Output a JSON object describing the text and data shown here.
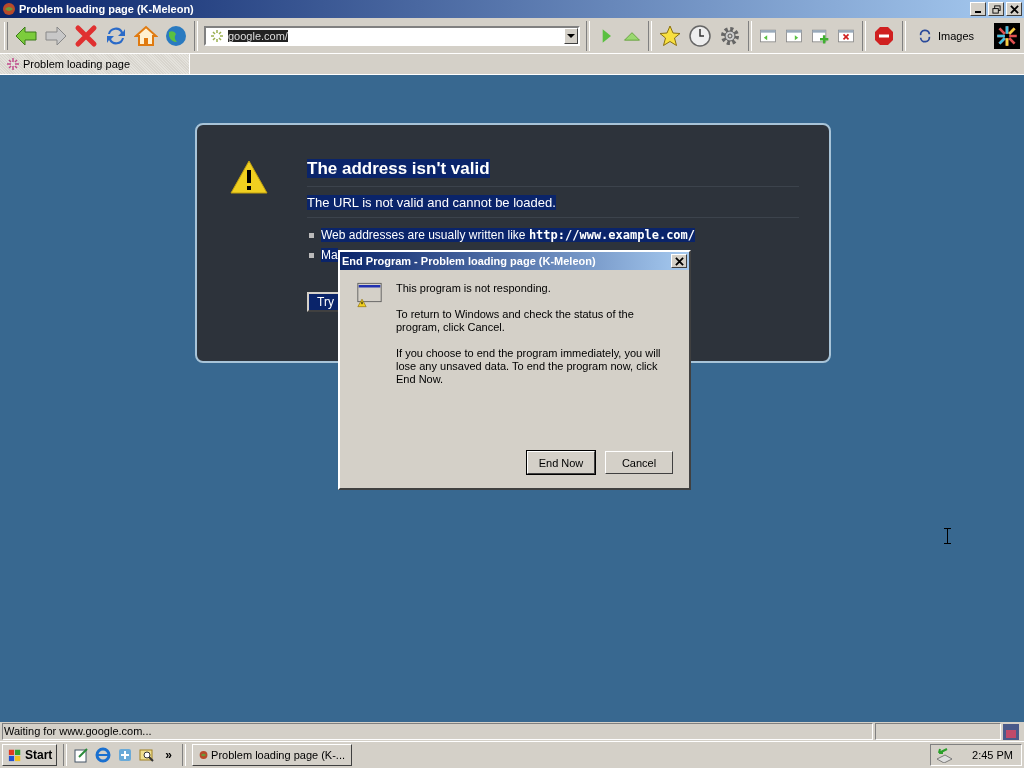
{
  "window": {
    "title": "Problem loading page (K-Meleon)"
  },
  "toolbar": {
    "address": "google.com/",
    "images_button": "Images"
  },
  "tabs": [
    {
      "label": "Problem loading page",
      "selected": true
    }
  ],
  "error_page": {
    "title": "The address isn't valid",
    "subtitle": "The URL is not valid and cannot be loaded.",
    "bullets": [
      "Web addresses are usually written like **http://www.example.com/**",
      "Ma"
    ],
    "button": "Try"
  },
  "dialog": {
    "title": "End Program - Problem loading page (K-Meleon)",
    "paragraphs": [
      "This program is not responding.",
      "To return to Windows and check the status of the program, click Cancel.",
      "If you choose to end the program immediately, you will lose any unsaved data. To end the program now, click End Now."
    ],
    "buttons": [
      {
        "label": "End Now",
        "default": true
      },
      {
        "label": "Cancel",
        "default": false
      }
    ]
  },
  "status_bar": {
    "text": "Waiting for www.google.com..."
  },
  "taskbar": {
    "start": "Start",
    "more": "»",
    "tasks": [
      {
        "label": "Problem loading page (K-...",
        "selected": false
      }
    ],
    "clock": "2:45 PM"
  }
}
